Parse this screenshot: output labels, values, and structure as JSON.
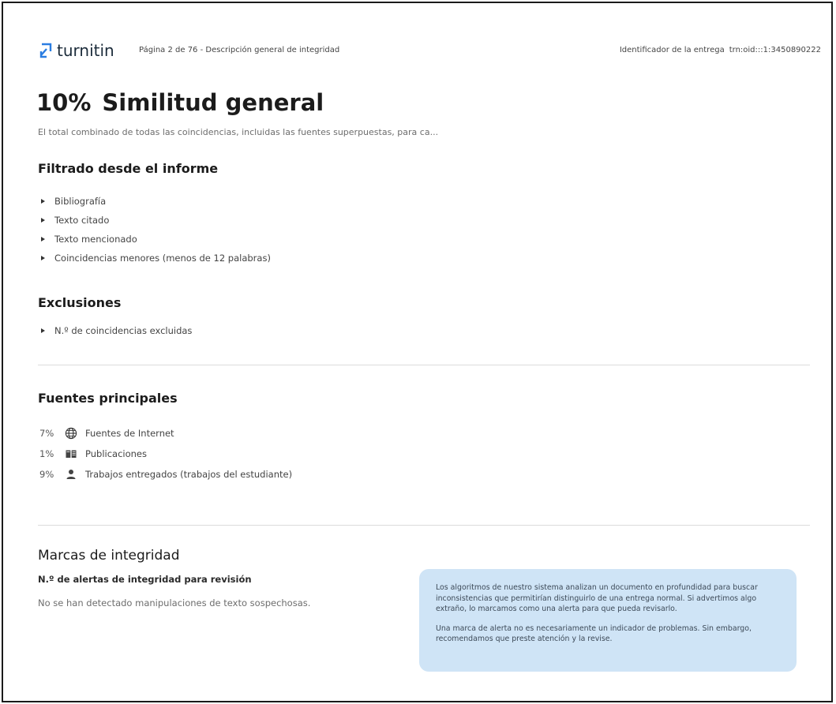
{
  "header": {
    "logo_text": "turnitin",
    "page_info": "Página 2 de 76 - Descripción general de integridad",
    "submission_label": "Identificador de la entrega",
    "submission_id": "trn:oid:::1:3450890222",
    "accent_color": "#2a7de1"
  },
  "overview": {
    "percent": "10%",
    "title": "Similitud general",
    "subtitle": "El total combinado de todas las coincidencias, incluidas las fuentes superpuestas, para ca..."
  },
  "filtered": {
    "heading": "Filtrado desde el informe",
    "items": [
      "Bibliografía",
      "Texto citado",
      "Texto mencionado",
      "Coincidencias menores (menos de 12 palabras)"
    ]
  },
  "exclusions": {
    "heading": "Exclusiones",
    "items": [
      "N.º de coincidencias excluidas"
    ]
  },
  "sources": {
    "heading": "Fuentes principales",
    "items": [
      {
        "percent": "7%",
        "icon": "globe-icon",
        "label": "Fuentes de Internet"
      },
      {
        "percent": "1%",
        "icon": "book-icon",
        "label": "Publicaciones"
      },
      {
        "percent": "9%",
        "icon": "person-icon",
        "label": "Trabajos entregados (trabajos del estudiante)"
      }
    ]
  },
  "integrity": {
    "heading": "Marcas de integridad",
    "alerts_label": "N.º de alertas de integridad para revisión",
    "no_alerts": "No se han detectado manipulaciones de texto sospechosas.",
    "info_p1": "Los algoritmos de nuestro sistema analizan un documento en profundidad para buscar inconsistencias que permitirían distinguirlo de una entrega normal. Si advertimos algo extraño, lo marcamos como una alerta para que pueda revisarlo.",
    "info_p2": "Una marca de alerta no es necesariamente un indicador de problemas. Sin embargo, recomendamos que preste atención y la revise.",
    "info_box_color": "#cfe4f6"
  }
}
